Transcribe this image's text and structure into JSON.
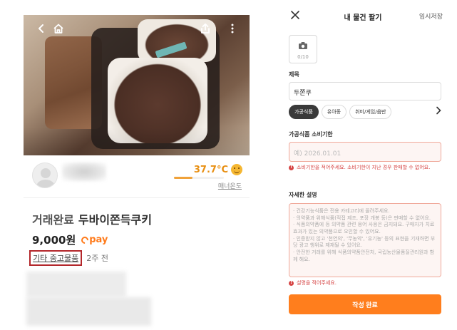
{
  "left": {
    "seller": {
      "temperature": "37.7°C",
      "temperature_level": 0.377,
      "manner_label": "매너온도"
    },
    "item": {
      "status": "거래완료",
      "title": "두바이쫀득쿠키",
      "price": "9,000원",
      "pay_label": "pay",
      "category": "기타 중고물품",
      "time_ago": "2주 전"
    },
    "icons": [
      "chevron-left-icon",
      "home-icon",
      "share-icon",
      "more-vertical-icon"
    ],
    "accent_color": "#e88f12"
  },
  "right": {
    "header": {
      "title": "내 물건 팔기",
      "save_label": "임시저장"
    },
    "photo": {
      "count": "0/10"
    },
    "title_section": {
      "label": "제목",
      "value": "두쫀쿠"
    },
    "chips": [
      "가공식품",
      "유아동",
      "취미/게임/음반"
    ],
    "expiry": {
      "label": "가공식품 소비기한",
      "placeholder": "예) 2026.01.01",
      "error": "소비기한을 적어주세요. 소비기한이 지난 경우 판매할 수 없어요."
    },
    "description": {
      "label": "자세한 설명",
      "lines": [
        "· 건강기능식품은 전용 카테고리에 올려주세요.",
        "· 의약품과 위해식품(직접 제조, 포장 개봉 등)은 판매할 수 없어요.",
        "· 식품의약품에 등 의약품 관련 용어 사용은 금지돼요. 구매자가 치료 효과가 있는 의약품으로 오인할 수 있어요.",
        "· 인증받지 않고 '천연의', '무농약', '유기농' 등의 표현을 기재하면 부당 광고 행위로 제재될 수 있어요.",
        "· 안전한 거래를 위해 식품의약품안전처, 국립농산물품질관리원과 함께 해요."
      ],
      "error": "설명을 적어주세요."
    },
    "submit_label": "작성 완료",
    "accent_color": "#ff7e1d",
    "error_color": "#d64545"
  }
}
